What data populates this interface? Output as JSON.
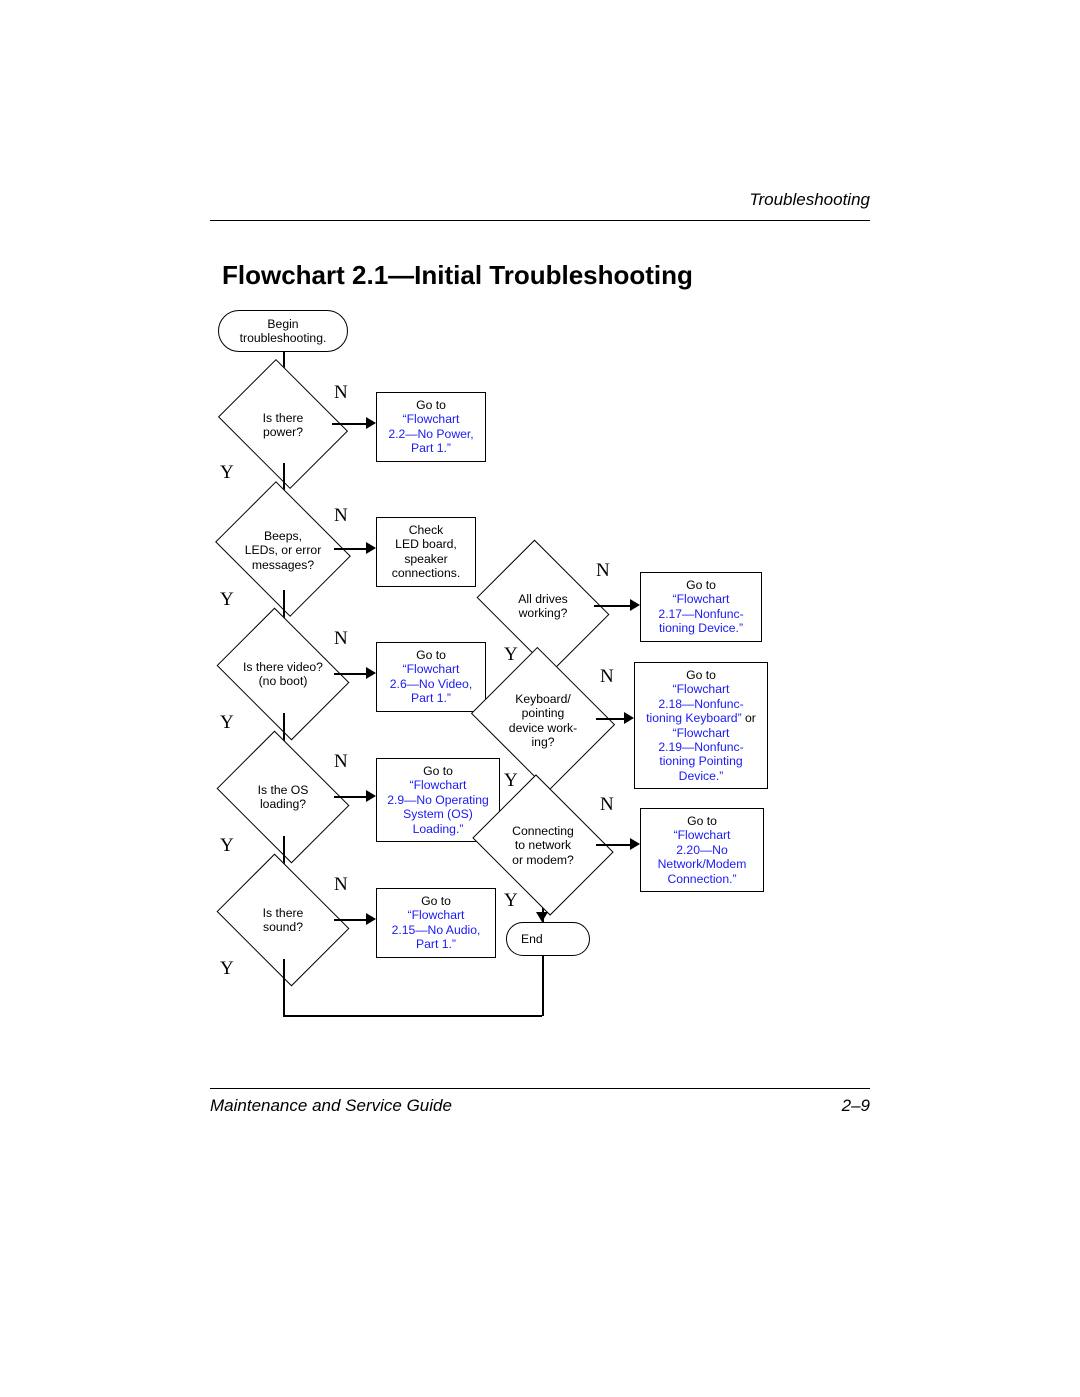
{
  "header": {
    "section": "Troubleshooting"
  },
  "title": "Flowchart 2.1—Initial Troubleshooting",
  "footer": {
    "left": "Maintenance and Service Guide",
    "right": "2–9"
  },
  "labels": {
    "yes": "Y",
    "no": "N"
  },
  "flow": {
    "begin": "Begin\ntroubleshooting.",
    "end": "End",
    "d1": "Is there\npower?",
    "d2": "Beeps,\nLEDs, or error\nmessages?",
    "d3": "Is there video?\n(no boot)",
    "d4": "Is the OS\nloading?",
    "d5": "Is there\nsound?",
    "d6": "All drives\nworking?",
    "d7": "Keyboard/\npointing\ndevice work-\ning?",
    "d8": "Connecting\nto network\nor modem?",
    "p1_pre": "Go to",
    "p1_link": "“Flowchart\n2.2—No Power,\nPart 1.”",
    "p2": "Check\nLED board,\nspeaker\nconnections.",
    "p3_pre": "Go to",
    "p3_link": "“Flowchart\n2.6—No Video,\nPart 1.”",
    "p4_pre": "Go to",
    "p4_link": "“Flowchart\n2.9—No Operating\nSystem (OS)\nLoading.”",
    "p5_pre": "Go to",
    "p5_link": "“Flowchart\n2.15—No Audio,\nPart 1.”",
    "p6_pre": "Go to",
    "p6_link": "“Flowchart\n2.17—Nonfunc-\ntioning Device.”",
    "p7_pre": "Go to",
    "p7_link1": "“Flowchart\n2.18—Nonfunc-\ntioning Keyboard”",
    "p7_mid": " or ",
    "p7_link2": "“Flowchart\n2.19—Nonfunc-\ntioning Pointing\nDevice.”",
    "p8_pre": "Go to",
    "p8_link": "“Flowchart\n2.20—No\nNetwork/Modem\nConnection.”"
  },
  "chart_data": {
    "type": "flowchart",
    "title": "Flowchart 2.1—Initial Troubleshooting",
    "nodes": [
      {
        "id": "begin",
        "type": "terminator",
        "text": "Begin troubleshooting."
      },
      {
        "id": "d1",
        "type": "decision",
        "text": "Is there power?"
      },
      {
        "id": "p1",
        "type": "process",
        "text": "Go to \"Flowchart 2.2—No Power, Part 1.\""
      },
      {
        "id": "d2",
        "type": "decision",
        "text": "Beeps, LEDs, or error messages?"
      },
      {
        "id": "p2",
        "type": "process",
        "text": "Check LED board, speaker connections."
      },
      {
        "id": "d3",
        "type": "decision",
        "text": "Is there video? (no boot)"
      },
      {
        "id": "p3",
        "type": "process",
        "text": "Go to \"Flowchart 2.6—No Video, Part 1.\""
      },
      {
        "id": "d4",
        "type": "decision",
        "text": "Is the OS loading?"
      },
      {
        "id": "p4",
        "type": "process",
        "text": "Go to \"Flowchart 2.9—No Operating System (OS) Loading.\""
      },
      {
        "id": "d5",
        "type": "decision",
        "text": "Is there sound?"
      },
      {
        "id": "p5",
        "type": "process",
        "text": "Go to \"Flowchart 2.15—No Audio, Part 1.\""
      },
      {
        "id": "d6",
        "type": "decision",
        "text": "All drives working?"
      },
      {
        "id": "p6",
        "type": "process",
        "text": "Go to \"Flowchart 2.17—Nonfunctioning Device.\""
      },
      {
        "id": "d7",
        "type": "decision",
        "text": "Keyboard/pointing device working?"
      },
      {
        "id": "p7",
        "type": "process",
        "text": "Go to \"Flowchart 2.18—Nonfunctioning Keyboard\" or \"Flowchart 2.19—Nonfunctioning Pointing Device.\""
      },
      {
        "id": "d8",
        "type": "decision",
        "text": "Connecting to network or modem?"
      },
      {
        "id": "p8",
        "type": "process",
        "text": "Go to \"Flowchart 2.20—No Network/Modem Connection.\""
      },
      {
        "id": "end",
        "type": "terminator",
        "text": "End"
      }
    ],
    "edges": [
      {
        "from": "begin",
        "to": "d1"
      },
      {
        "from": "d1",
        "to": "p1",
        "label": "N"
      },
      {
        "from": "d1",
        "to": "d2",
        "label": "Y"
      },
      {
        "from": "d2",
        "to": "p2",
        "label": "N"
      },
      {
        "from": "d2",
        "to": "d3",
        "label": "Y"
      },
      {
        "from": "d3",
        "to": "p3",
        "label": "N"
      },
      {
        "from": "d3",
        "to": "d4",
        "label": "Y"
      },
      {
        "from": "d4",
        "to": "p4",
        "label": "N"
      },
      {
        "from": "d4",
        "to": "d5",
        "label": "Y"
      },
      {
        "from": "d5",
        "to": "p5",
        "label": "N"
      },
      {
        "from": "d5",
        "to": "d6",
        "label": "Y"
      },
      {
        "from": "d6",
        "to": "p6",
        "label": "N"
      },
      {
        "from": "d6",
        "to": "d7",
        "label": "Y"
      },
      {
        "from": "d7",
        "to": "p7",
        "label": "N"
      },
      {
        "from": "d7",
        "to": "d8",
        "label": "Y"
      },
      {
        "from": "d8",
        "to": "p8",
        "label": "N"
      },
      {
        "from": "d8",
        "to": "end",
        "label": "Y"
      }
    ]
  }
}
